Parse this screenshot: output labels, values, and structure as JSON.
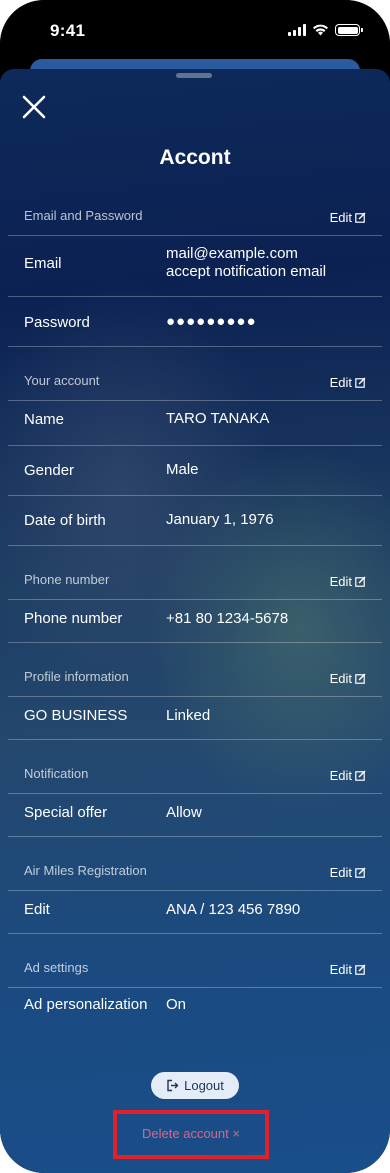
{
  "status_bar": {
    "time": "9:41"
  },
  "sheet": {
    "title": "Accont",
    "close_label": "close"
  },
  "sections": {
    "email_password": {
      "label": "Email and Password",
      "edit": "Edit",
      "email_label": "Email",
      "email_value": "mail@example.com",
      "email_note": "accept notification email",
      "password_label": "Password",
      "password_mask": "●●●●●●●●●"
    },
    "account": {
      "label": "Your account",
      "edit": "Edit",
      "name_label": "Name",
      "name_value": "TARO TANAKA",
      "gender_label": "Gender",
      "gender_value": "Male",
      "dob_label": "Date of birth",
      "dob_value": "January 1, 1976"
    },
    "phone": {
      "label": "Phone number",
      "edit": "Edit",
      "phone_label": "Phone number",
      "phone_value": "+81 80 1234-5678"
    },
    "profile": {
      "label": "Profile information",
      "edit": "Edit",
      "business_label": "GO BUSINESS",
      "business_value": "Linked"
    },
    "notification": {
      "label": "Notification",
      "edit": "Edit",
      "offer_label": "Special offer",
      "offer_value": "Allow"
    },
    "air_miles": {
      "label": "Air Miles Registration",
      "edit": "Edit",
      "miles_label": "Edit",
      "miles_value": "ANA / 123 456 7890"
    },
    "ad": {
      "label": "Ad settings",
      "edit": "Edit",
      "ad_label": "Ad personalization",
      "ad_value": "On"
    }
  },
  "actions": {
    "logout": "Logout",
    "delete_account": "Delete account ×"
  },
  "colors": {
    "highlight_border": "#e0202a",
    "delete_text": "#d06a8c",
    "logout_bg": "#e4edf7"
  }
}
